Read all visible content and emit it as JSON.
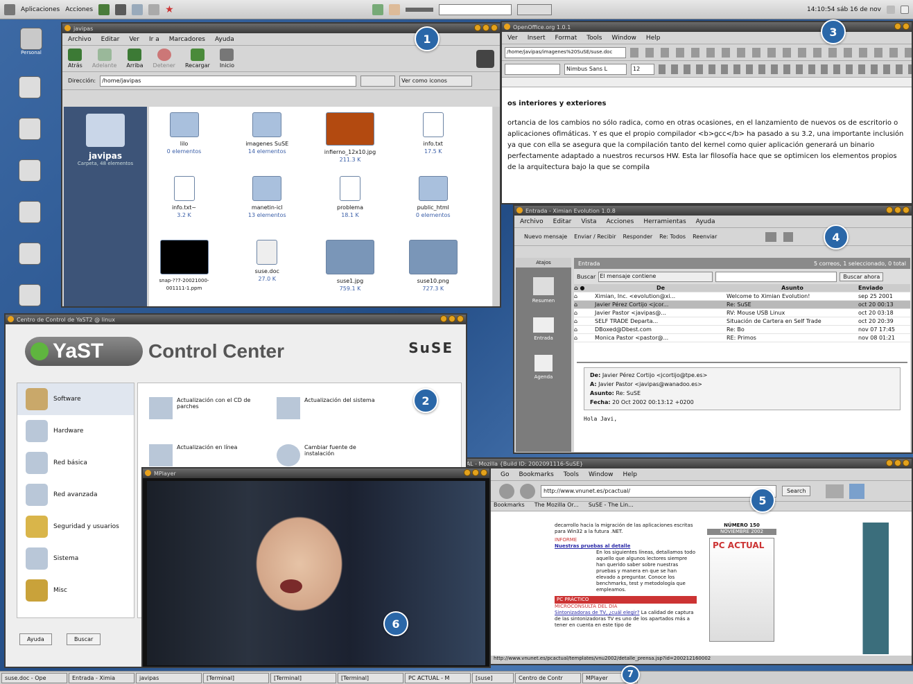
{
  "panel": {
    "apps": "Aplicaciones",
    "actions": "Acciones",
    "clock": "14:10:54 sáb 16 de nov"
  },
  "desktop": {
    "home_label": "Personal",
    "icons": [
      "",
      "",
      "",
      "",
      "",
      ""
    ]
  },
  "nautilus": {
    "title": "javipas",
    "menu": [
      "Archivo",
      "Editar",
      "Ver",
      "Ir a",
      "Marcadores",
      "Ayuda"
    ],
    "toolbar": [
      "Atrás",
      "Adelante",
      "Arriba",
      "Detener",
      "Recargar",
      "Inicio"
    ],
    "address_label": "Dirección:",
    "address": "/home/javipas",
    "view_mode": "Ver como iconos",
    "sidebar_name": "javipas",
    "sidebar_info": "Carpeta, 48 elementos",
    "files": [
      {
        "name": "lilo",
        "info": "0 elementos"
      },
      {
        "name": "imagenes SuSE",
        "info": "14 elementos"
      },
      {
        "name": "infierno_12x10.jpg",
        "info": "211.3 K"
      },
      {
        "name": "info.txt",
        "info": "17.5 K"
      },
      {
        "name": "info.txt~",
        "info": "3.2 K"
      },
      {
        "name": "manetin-icl",
        "info": "13 elementos"
      },
      {
        "name": "problema",
        "info": "18.1 K"
      },
      {
        "name": "public_html",
        "info": "0 elementos"
      },
      {
        "name": "snap-??7-20021000-001111-1.ppm",
        "info": ""
      },
      {
        "name": "suse.doc",
        "info": "27.0 K"
      },
      {
        "name": "suse1.jpg",
        "info": "759.1 K"
      },
      {
        "name": "suse10.png",
        "info": "727.3 K"
      }
    ]
  },
  "oo": {
    "title": "OpenOffice.org 1.0.1",
    "menu": [
      "Ver",
      "Insert",
      "Format",
      "Tools",
      "Window",
      "Help"
    ],
    "file_path": "/home/javipas/imagenes%20SuSE/suse.doc",
    "font": "Nimbus Sans L",
    "size": "12",
    "heading": "os interiores y exteriores",
    "body": "ortancia de los cambios no sólo radica, como en otras ocasiones, en el lanzamiento de nuevos os de escritorio o aplicaciones ofimáticas. Y es que el propio compilador <b>gcc</b> ha pasado a su 3.2, una importante inclusión ya que con ella se asegura que la compilación tanto del kernel como quier aplicación generará un binario perfectamente adaptado a nuestros recursos HW. Esta lar filosofía hace que se optimicen los elementos propios de la arquitectura bajo la que se compila"
  },
  "yast": {
    "title": "Centro de Control de YaST2 @ linux",
    "header": "YaST Control Center",
    "brand": "SuSE",
    "categories": [
      "Software",
      "Hardware",
      "Red básica",
      "Red avanzada",
      "Seguridad y usuarios",
      "Sistema",
      "Misc"
    ],
    "modules": [
      "Actualización con el CD de parches",
      "Actualización del sistema",
      "Actualización en línea",
      "Cambiar fuente de instalación"
    ],
    "help": "Ayuda",
    "search": "Buscar"
  },
  "evo": {
    "title": "Entrada - Ximian Evolution 1.0.8",
    "menu": [
      "Archivo",
      "Editar",
      "Vista",
      "Acciones",
      "Herramientas",
      "Ayuda"
    ],
    "toolbar": [
      "Nuevo mensaje",
      "Enviar / Recibir",
      "Responder",
      "Re: Todos",
      "Reenviar"
    ],
    "folder": "Entrada",
    "status": "5 correos, 1 seleccionado, 0 total",
    "shortcut_title": "Atajos",
    "shortcuts": [
      "Resumen",
      "Entrada",
      "Agenda"
    ],
    "search_label": "Buscar",
    "search_mode": "El mensaje contiene",
    "search_btn": "Buscar ahora",
    "cols": [
      "De",
      "Asunto",
      "Enviado"
    ],
    "msgs": [
      {
        "from": "Ximian, Inc. <evolution@xi...",
        "subject": "Welcome to Ximian Evolution!",
        "date": "sep 25 2001"
      },
      {
        "from": "Javier Pérez Cortijo <jcor...",
        "subject": "Re: SuSE",
        "date": "oct 20 00:13"
      },
      {
        "from": "Javier Pastor <javipas@...",
        "subject": "RV: Mouse USB Linux",
        "date": "oct 20 03:18"
      },
      {
        "from": "SELF TRADE Departa...",
        "subject": "Situación de Cartera en Self Trade",
        "date": "oct 20 20:39"
      },
      {
        "from": "DBoxed@Dbest.com",
        "subject": "Re: Bo",
        "date": "nov 07 17:45"
      },
      {
        "from": "Monica Pastor <pastor@...",
        "subject": "RE: Primos",
        "date": "nov 08 01:21"
      }
    ],
    "preview": {
      "from_label": "De:",
      "from": "Javier Pérez Cortijo <jcortijo@tpe.es>",
      "to_label": "A:",
      "to": "Javier Pastor <javipas@wanadoo.es>",
      "subj_label": "Asunto:",
      "subj": "Re: SuSE",
      "date_label": "Fecha:",
      "date": "20 Oct 2002 00:13:12 +0200",
      "body": "Hola Javi,"
    }
  },
  "moz": {
    "title": "PC ACTUAL - Mozilla {Build ID: 2002091116-SuSE}",
    "menu": [
      "Go",
      "Bookmarks",
      "Tools",
      "Window",
      "Help"
    ],
    "url": "http://www.vnunet.es/pcactual/",
    "search": "Search",
    "bookmarks": [
      "Bookmarks",
      "The Mozilla Or...",
      "SuSE - The Lin..."
    ],
    "status_url": "http://www.vnunet.es/pcactual/templates/vnu2002/detalle_prensa.jsp?id=200212160002",
    "article": {
      "lead": "decarrollo hacia la migración de las aplicaciones escritas para Win32 a la futura .NET.",
      "informe": "INFORME",
      "link1": "Nuestras pruebas al detalle",
      "text1": "En los siguientes líneas, detallamos todo aquello que algunos lectores siempre han querido saber sobre nuestras pruebas y manera en que se han elevado a preguntar. Conoce los benchmarks, test y metodología que empleamos.",
      "practico": "PC PRÁCTICO",
      "micro": "MICROCONSULTA DEL DÍA",
      "link2": "Sintonizadoras de TV, ¿cuál elegir?",
      "text2": "La calidad de captura de las sintonizadoras TV es uno de los apartados más a tener en cuenta en este tipo de"
    },
    "side_head": "NÚMERO 150",
    "side_sub": "NOVIEMBRE 2002",
    "cover": "PC ACTUAL"
  },
  "mplayer": {
    "title": "MPlayer"
  },
  "taskbar": [
    "suse.doc - Ope",
    "Entrada - Ximia",
    "javipas",
    "[Terminal]",
    "[Terminal]",
    "[Terminal]",
    "PC ACTUAL - M",
    "[suse]",
    "Centro de Contr",
    "MPlayer"
  ],
  "badges": [
    "1",
    "2",
    "3",
    "4",
    "5",
    "6",
    "7"
  ]
}
